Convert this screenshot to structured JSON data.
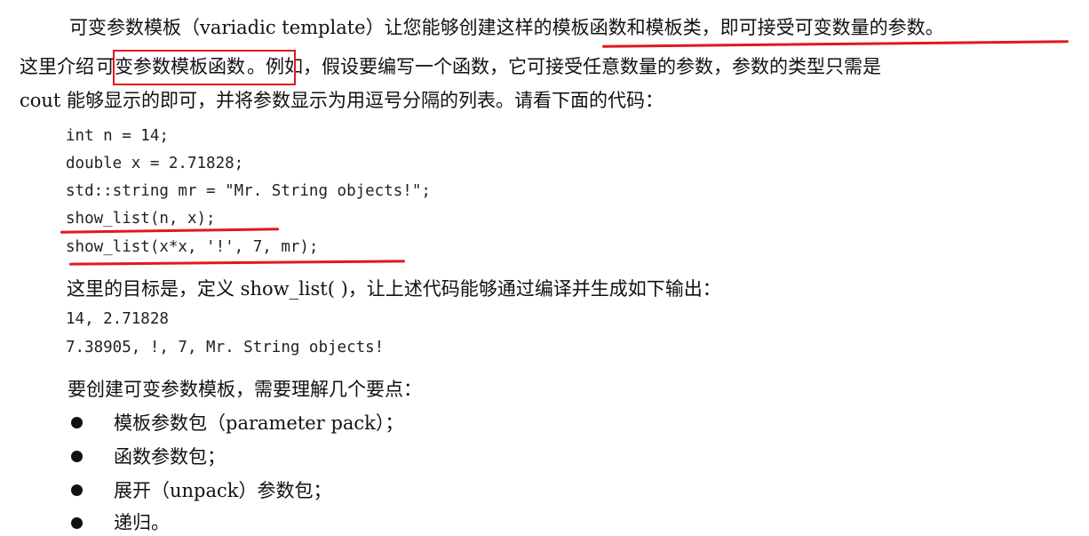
{
  "paragraph1": {
    "line1_a": "可变参数模板（variadic template）让您能够创建这样的",
    "line1_b": "模板函数和模板类，即可接受可变数量的参数。",
    "line2_a": "这里介绍",
    "line2_b": "可变参数模板函数",
    "line2_c": "。例如，假设要编写一个函数，它可接受任意数量的参数，参数的类型只需是",
    "line3": "cout 能够显示的即可，并将参数显示为用逗号分隔的列表。请看下面的代码："
  },
  "code_block": [
    "int n = 14;",
    "double x = 2.71828;",
    "std::string mr = \"Mr. String objects!\";",
    "show_list(n, x);",
    "show_list(x*x, '!', 7, mr);"
  ],
  "paragraph2": "这里的目标是，定义 show_list( )，让上述代码能够通过编译并生成如下输出：",
  "output_block": [
    "14, 2.71828",
    "7.38905, !, 7, Mr. String objects!"
  ],
  "paragraph3": "要创建可变参数模板，需要理解几个要点：",
  "bullets": [
    "模板参数包（parameter pack）；",
    "函数参数包；",
    "展开（unpack）参数包；",
    "递归。"
  ],
  "colors": {
    "annotation": "#e0191e"
  }
}
